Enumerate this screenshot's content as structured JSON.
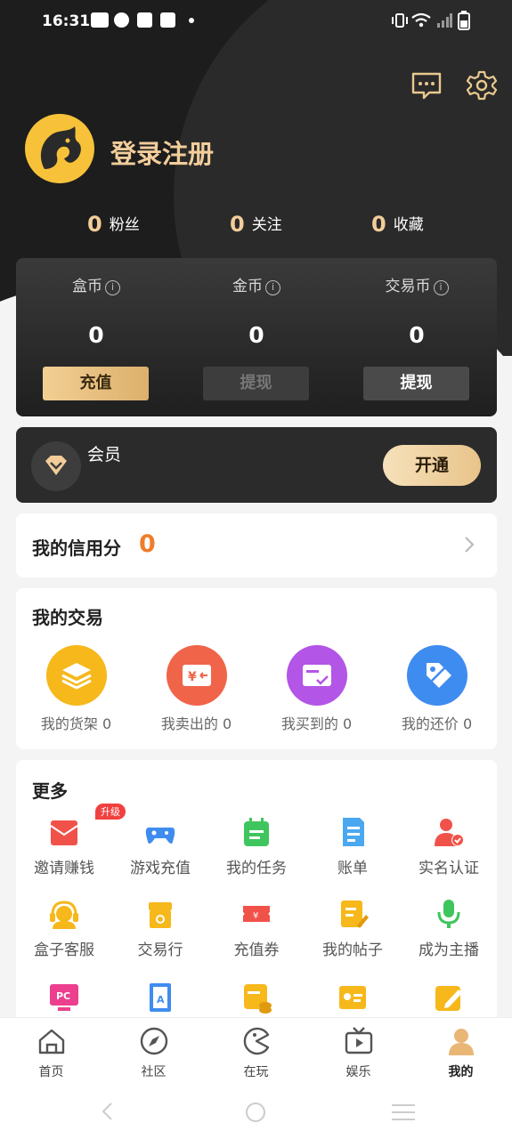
{
  "status": {
    "time": "16:31"
  },
  "profile": {
    "login_label": "登录注册"
  },
  "stats": [
    {
      "count": "0",
      "label": "粉丝"
    },
    {
      "count": "0",
      "label": "关注"
    },
    {
      "count": "0",
      "label": "收藏"
    }
  ],
  "wallet": [
    {
      "label": "盒币",
      "value": "0",
      "button": "充值"
    },
    {
      "label": "金币",
      "value": "0",
      "button": "提现"
    },
    {
      "label": "交易币",
      "value": "0",
      "button": "提现"
    }
  ],
  "vip": {
    "label": "会员",
    "button": "开通"
  },
  "credit": {
    "label": "我的信用分",
    "score": "0"
  },
  "trade": {
    "title": "我的交易",
    "items": [
      {
        "label": "我的货架 0",
        "color": "#f6b81a",
        "icon": "layers-icon"
      },
      {
        "label": "我卖出的 0",
        "color": "#f06449",
        "icon": "sold-icon"
      },
      {
        "label": "我买到的 0",
        "color": "#b355e6",
        "icon": "bought-icon"
      },
      {
        "label": "我的还价 0",
        "color": "#3f8cf0",
        "icon": "price-tag-icon"
      }
    ]
  },
  "more": {
    "title": "更多",
    "badge": "升级",
    "items": [
      {
        "label": "邀请赚钱",
        "color": "#f0524a",
        "icon": "red-envelope-icon"
      },
      {
        "label": "游戏充值",
        "color": "#3f8cf0",
        "icon": "gamepad-icon"
      },
      {
        "label": "我的任务",
        "color": "#3fc55e",
        "icon": "calendar-icon"
      },
      {
        "label": "账单",
        "color": "#4aa8f0",
        "icon": "bill-icon"
      },
      {
        "label": "实名认证",
        "color": "#f0524a",
        "icon": "verified-user-icon"
      },
      {
        "label": "盒子客服",
        "color": "#f6b81a",
        "icon": "headset-icon"
      },
      {
        "label": "交易行",
        "color": "#f6b81a",
        "icon": "shop-icon"
      },
      {
        "label": "充值券",
        "color": "#f0524a",
        "icon": "coupon-icon"
      },
      {
        "label": "我的帖子",
        "color": "#f6b81a",
        "icon": "post-icon"
      },
      {
        "label": "成为主播",
        "color": "#3fc55e",
        "icon": "microphone-icon"
      },
      {
        "label": "",
        "color": "#ec3f8e",
        "icon": "pc-icon",
        "icon_text": "PC"
      },
      {
        "label": "",
        "color": "#3f8cf0",
        "icon": "dictionary-icon"
      },
      {
        "label": "",
        "color": "#f6b81a",
        "icon": "coins-icon"
      },
      {
        "label": "",
        "color": "#f6b81a",
        "icon": "id-card-icon"
      },
      {
        "label": "",
        "color": "#f6b81a",
        "icon": "edit-icon"
      }
    ]
  },
  "tabs": [
    {
      "label": "首页",
      "icon": "home-icon"
    },
    {
      "label": "社区",
      "icon": "compass-icon"
    },
    {
      "label": "在玩",
      "icon": "pacman-icon"
    },
    {
      "label": "娱乐",
      "icon": "tv-icon"
    },
    {
      "label": "我的",
      "icon": "user-icon",
      "active": true
    }
  ]
}
